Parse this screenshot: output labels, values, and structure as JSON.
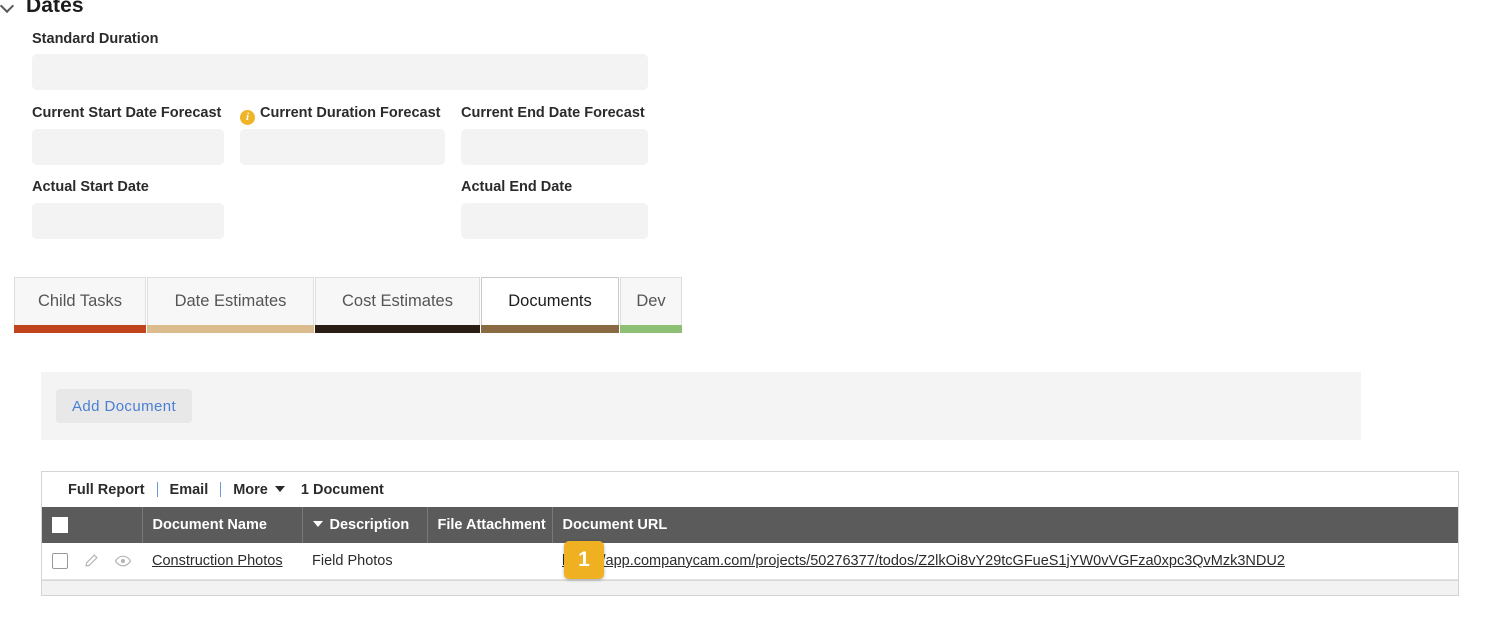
{
  "section": {
    "title": "Dates",
    "collapse_icon": "chevron-down-icon"
  },
  "fields": [
    {
      "label": "Standard Duration",
      "value": "",
      "has_info_icon": false
    },
    {
      "label": "Current Start Date Forecast",
      "value": "",
      "has_info_icon": false
    },
    {
      "label": "Current Duration Forecast",
      "value": "",
      "has_info_icon": true,
      "info_icon": "info-circle-icon"
    },
    {
      "label": "Current End Date Forecast",
      "value": "",
      "has_info_icon": false
    },
    {
      "label": "Actual Start Date",
      "value": "",
      "has_info_icon": false
    },
    {
      "label": "Actual End Date",
      "value": "",
      "has_info_icon": false
    }
  ],
  "tabs": [
    {
      "label": "Child Tasks",
      "active": false,
      "color": "#c0441e"
    },
    {
      "label": "Date Estimates",
      "active": false,
      "color": "#dbbc8e"
    },
    {
      "label": "Cost Estimates",
      "active": false,
      "color": "#2a1d13"
    },
    {
      "label": "Documents",
      "active": true,
      "color": "#8a6a43"
    },
    {
      "label": "Dev",
      "active": false,
      "color": "#8dbf75"
    }
  ],
  "action_panel": {
    "add_document_label": "Add  Document"
  },
  "list": {
    "toolbar": {
      "full_report_label": "Full Report",
      "email_label": "Email",
      "more_label": "More",
      "more_caret_icon": "caret-down-icon",
      "count_label": "1 Document"
    },
    "columns": [
      {
        "key": "check",
        "label": ""
      },
      {
        "key": "name",
        "label": "Document Name"
      },
      {
        "key": "description",
        "label": "Description",
        "sorted": true,
        "sort_icon": "sort-caret-down-icon"
      },
      {
        "key": "file",
        "label": "File Attachment"
      },
      {
        "key": "url",
        "label": "Document URL"
      }
    ],
    "rows": [
      {
        "selected": false,
        "edit_icon": "pencil-icon",
        "view_icon": "eye-icon",
        "name": "Construction Photos",
        "description": "Field Photos",
        "file_attachment": "",
        "url": "https://app.companycam.com/projects/50276377/todos/Z2lkOi8vY29tcGFueS1jYW0vVGFza0xpc3QvMzk3NDU2"
      }
    ]
  },
  "step_marker": {
    "number": "1"
  },
  "colors": {
    "header_gray": "#5b5b5b",
    "badge_amber": "#efb021",
    "link_blue": "#4a7fd4",
    "input_gray": "#f3f3f3",
    "info_icon_amber": "#f0b429"
  }
}
